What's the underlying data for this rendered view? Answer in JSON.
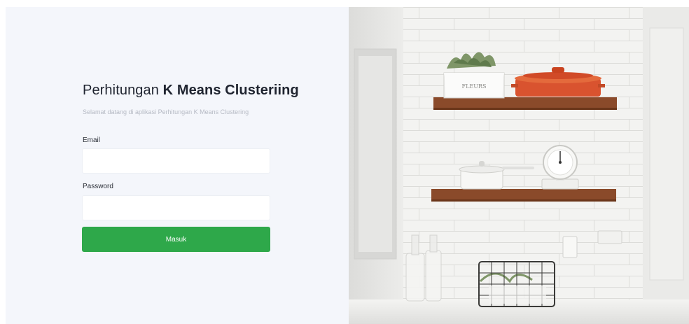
{
  "login": {
    "title_prefix": "Perhitungan ",
    "title_bold": "K Means Clusteriing",
    "subtitle": "Selamat datang di aplikasi Perhitungan K Means Clustering",
    "email_label": "Email",
    "email_value": "",
    "password_label": "Password",
    "password_value": "",
    "submit_label": "Masuk"
  },
  "photo": {
    "pot_text": "FLEURS"
  },
  "colors": {
    "accent": "#2ea84a",
    "panel_bg": "#f4f6fb",
    "shelf_wood": "#8a4a2a",
    "dish_red": "#d9532f"
  }
}
